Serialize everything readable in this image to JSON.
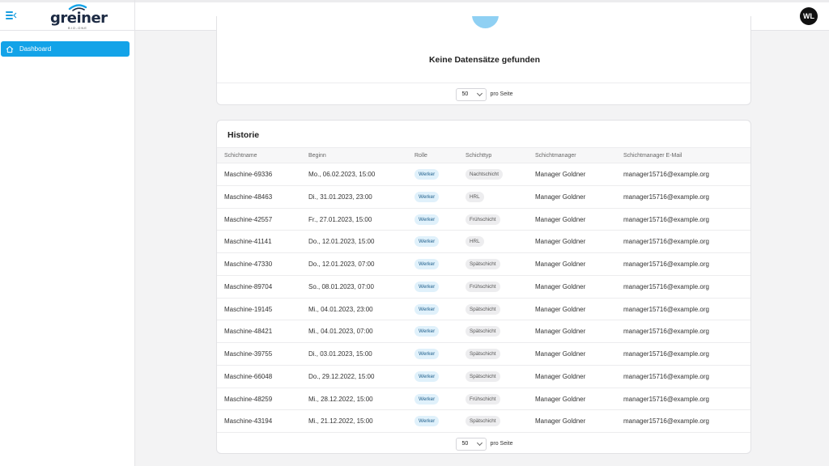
{
  "header": {
    "logo_text": "greiner",
    "logo_sub": "BIO-ONE",
    "avatar": "WL"
  },
  "sidebar": {
    "items": [
      {
        "label": "Dashboard",
        "icon": "home-icon",
        "active": true
      }
    ]
  },
  "colors": {
    "accent": "#13a3e8",
    "avatar_bg": "#111111"
  },
  "empty_card": {
    "message": "Keine Datensätze gefunden",
    "per_page_value": "50",
    "per_page_label": "pro Seite"
  },
  "history": {
    "title": "Historie",
    "columns": [
      "Schichtname",
      "Beginn",
      "Rolle",
      "Schichttyp",
      "Schichtmanager",
      "Schichtmanager E-Mail"
    ],
    "rows": [
      {
        "name": "Maschine-69336",
        "start": "Mo., 06.02.2023, 15:00",
        "role": "Werker",
        "type": "Nachtschicht",
        "manager": "Manager Goldner",
        "email": "manager15716@example.org"
      },
      {
        "name": "Maschine-48463",
        "start": "Di., 31.01.2023, 23:00",
        "role": "Werker",
        "type": "HRL",
        "manager": "Manager Goldner",
        "email": "manager15716@example.org"
      },
      {
        "name": "Maschine-42557",
        "start": "Fr., 27.01.2023, 15:00",
        "role": "Werker",
        "type": "Frühschicht",
        "manager": "Manager Goldner",
        "email": "manager15716@example.org"
      },
      {
        "name": "Maschine-41141",
        "start": "Do., 12.01.2023, 15:00",
        "role": "Werker",
        "type": "HRL",
        "manager": "Manager Goldner",
        "email": "manager15716@example.org"
      },
      {
        "name": "Maschine-47330",
        "start": "Do., 12.01.2023, 07:00",
        "role": "Werker",
        "type": "Spätschicht",
        "manager": "Manager Goldner",
        "email": "manager15716@example.org"
      },
      {
        "name": "Maschine-89704",
        "start": "So., 08.01.2023, 07:00",
        "role": "Werker",
        "type": "Frühschicht",
        "manager": "Manager Goldner",
        "email": "manager15716@example.org"
      },
      {
        "name": "Maschine-19145",
        "start": "Mi., 04.01.2023, 23:00",
        "role": "Werker",
        "type": "Spätschicht",
        "manager": "Manager Goldner",
        "email": "manager15716@example.org"
      },
      {
        "name": "Maschine-48421",
        "start": "Mi., 04.01.2023, 07:00",
        "role": "Werker",
        "type": "Spätschicht",
        "manager": "Manager Goldner",
        "email": "manager15716@example.org"
      },
      {
        "name": "Maschine-39755",
        "start": "Di., 03.01.2023, 15:00",
        "role": "Werker",
        "type": "Spätschicht",
        "manager": "Manager Goldner",
        "email": "manager15716@example.org"
      },
      {
        "name": "Maschine-66048",
        "start": "Do., 29.12.2022, 15:00",
        "role": "Werker",
        "type": "Spätschicht",
        "manager": "Manager Goldner",
        "email": "manager15716@example.org"
      },
      {
        "name": "Maschine-48259",
        "start": "Mi., 28.12.2022, 15:00",
        "role": "Werker",
        "type": "Frühschicht",
        "manager": "Manager Goldner",
        "email": "manager15716@example.org"
      },
      {
        "name": "Maschine-43194",
        "start": "Mi., 21.12.2022, 15:00",
        "role": "Werker",
        "type": "Spätschicht",
        "manager": "Manager Goldner",
        "email": "manager15716@example.org"
      }
    ],
    "per_page_value": "50",
    "per_page_label": "pro Seite"
  }
}
